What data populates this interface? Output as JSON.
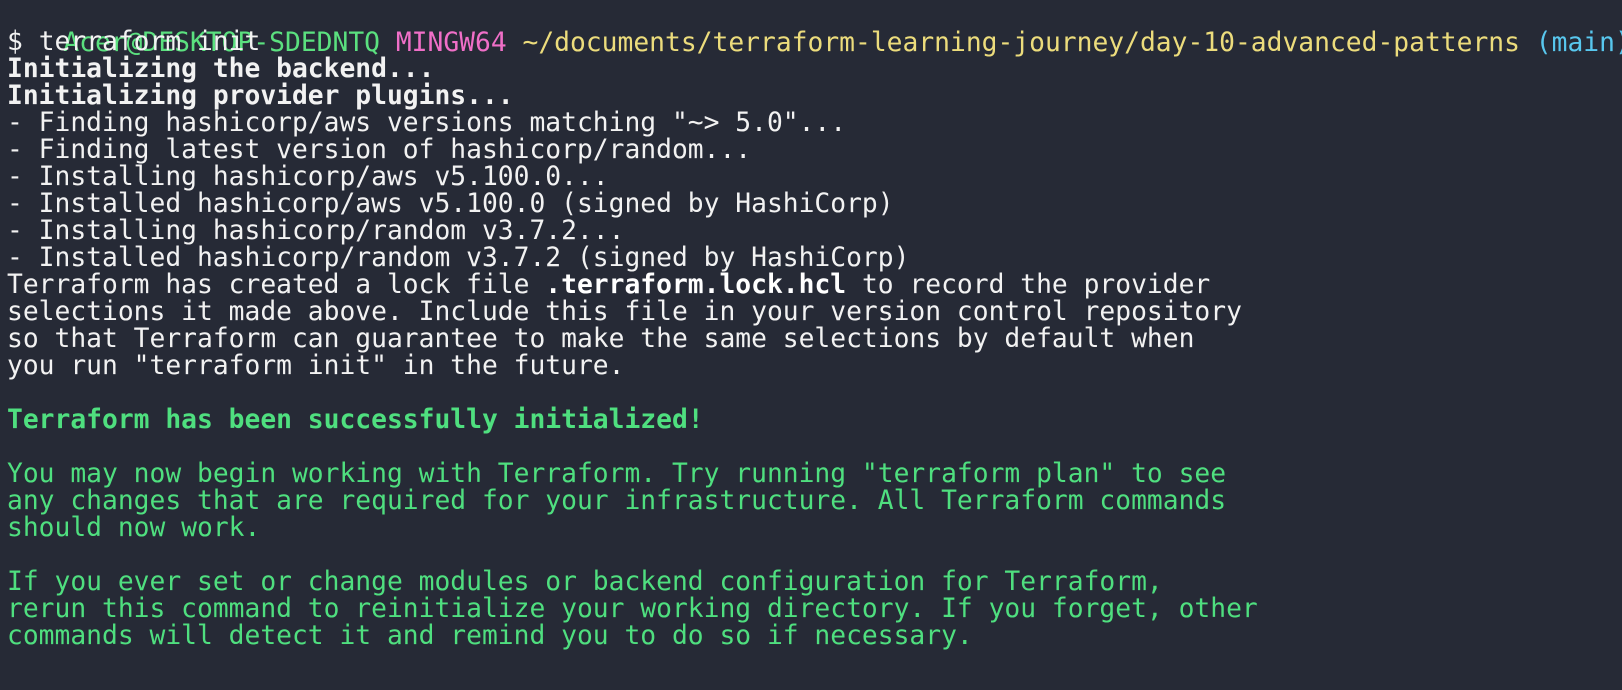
{
  "prompt": {
    "user_host": "Acer@DESKTOP-SDEDNTQ",
    "shell": "MINGW64",
    "path": "~/documents/terraform-learning-journey/day-10-advanced-patterns",
    "branch": "(main)",
    "symbol": "$",
    "command": "terraform init"
  },
  "output": {
    "backend": "Initializing the backend...",
    "provider_plugins": "Initializing provider plugins...",
    "steps": [
      "- Finding hashicorp/aws versions matching \"~> 5.0\"...",
      "- Finding latest version of hashicorp/random...",
      "- Installing hashicorp/aws v5.100.0...",
      "- Installed hashicorp/aws v5.100.0 (signed by HashiCorp)",
      "- Installing hashicorp/random v3.7.2...",
      "- Installed hashicorp/random v3.7.2 (signed by HashiCorp)"
    ],
    "lock_pre": "Terraform has created a lock file ",
    "lock_file": ".terraform.lock.hcl",
    "lock_post": " to record the provider",
    "lock_lines": [
      "selections it made above. Include this file in your version control repository",
      "so that Terraform can guarantee to make the same selections by default when",
      "you run \"terraform init\" in the future."
    ],
    "success": "Terraform has been successfully initialized!",
    "next_lines": [
      "You may now begin working with Terraform. Try running \"terraform plan\" to see",
      "any changes that are required for your infrastructure. All Terraform commands",
      "should now work."
    ],
    "rerun_lines": [
      "If you ever set or change modules or backend configuration for Terraform,",
      "rerun this command to reinitialize your working directory. If you forget, other",
      "commands will detect it and remind you to do so if necessary."
    ]
  },
  "colors": {
    "background": "#262a36",
    "text": "#f2f2f2",
    "success_green": "#4fdf7f",
    "prompt_user": "#5be07f",
    "prompt_shell": "#f06fc8",
    "prompt_path": "#ecdc7c",
    "prompt_branch": "#58c7ee"
  }
}
